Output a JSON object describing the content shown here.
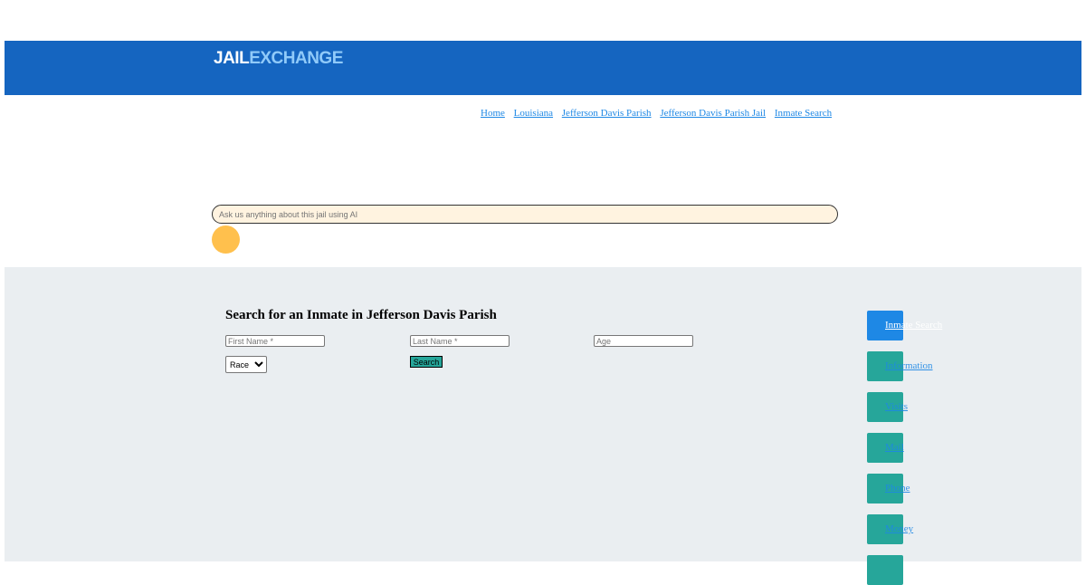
{
  "header": {
    "logo_part1": "JAIL",
    "logo_part2": "EXCHANGE",
    "bg_color": "#1565c0"
  },
  "breadcrumb": [
    "Home",
    "Louisiana",
    "Jefferson Davis Parish",
    "Jefferson Davis Parish Jail",
    "Inmate Search"
  ],
  "ai": {
    "placeholder": "Ask us anything about this jail using AI"
  },
  "search": {
    "title": "Search for an Inmate in Jefferson Davis Parish",
    "first_name_placeholder": "First Name *",
    "last_name_placeholder": "Last Name *",
    "age_placeholder": "Age",
    "race_selected": "Race",
    "search_label": "Search"
  },
  "side_nav": [
    "Inmate Search",
    "Information",
    "Visits",
    "Mail",
    "Phone",
    "Money",
    ""
  ]
}
